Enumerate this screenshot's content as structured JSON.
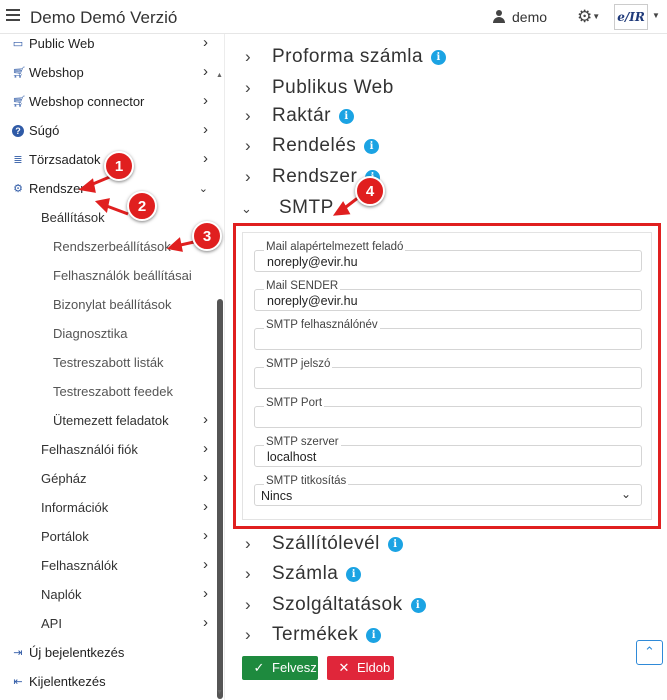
{
  "header": {
    "app_title": "Demo Demó Verzió",
    "user_name": "demo",
    "logo_text": "e/IR"
  },
  "sidebar": {
    "items": [
      {
        "label": "Public Web",
        "icon": "monitor-icon"
      },
      {
        "label": "Webshop",
        "icon": "cart-icon"
      },
      {
        "label": "Webshop connector",
        "icon": "cart-icon"
      },
      {
        "label": "Súgó",
        "icon": "question-icon"
      },
      {
        "label": "Törzsadatok",
        "icon": "database-icon"
      },
      {
        "label": "Rendszer",
        "icon": "gears-icon"
      },
      {
        "label": "Beállítások"
      },
      {
        "label": "Rendszerbeállítások"
      },
      {
        "label": "Felhasználók beállításai"
      },
      {
        "label": "Bizonylat beállítások"
      },
      {
        "label": "Diagnosztika"
      },
      {
        "label": "Testreszabott listák"
      },
      {
        "label": "Testreszabott feedek"
      },
      {
        "label": "Ütemezett feladatok"
      },
      {
        "label": "Felhasználói fiók"
      },
      {
        "label": "Gépház"
      },
      {
        "label": "Információk"
      },
      {
        "label": "Portálok"
      },
      {
        "label": "Felhasználók"
      },
      {
        "label": "Naplók"
      },
      {
        "label": "API"
      },
      {
        "label": "Új bejelentkezés",
        "icon": "sign-in-icon"
      },
      {
        "label": "Kijelentkezés",
        "icon": "sign-out-icon"
      }
    ]
  },
  "callouts": [
    "1",
    "2",
    "3",
    "4"
  ],
  "sections": [
    {
      "title": "Proforma számla",
      "info": true
    },
    {
      "title": "Publikus Web",
      "info": false
    },
    {
      "title": "Raktár",
      "info": true
    },
    {
      "title": "Rendelés",
      "info": true
    },
    {
      "title": "Rendszer",
      "info": true
    },
    {
      "title": "SMTP",
      "info": false
    },
    {
      "title": "Szállítólevél",
      "info": true
    },
    {
      "title": "Számla",
      "info": true
    },
    {
      "title": "Szolgáltatások",
      "info": true
    },
    {
      "title": "Termékek",
      "info": true
    }
  ],
  "smtp": {
    "fields": [
      {
        "label": "Mail alapértelmezett feladó",
        "value": "noreply@evir.hu"
      },
      {
        "label": "Mail SENDER",
        "value": "noreply@evir.hu"
      },
      {
        "label": "SMTP felhasználónév",
        "value": ""
      },
      {
        "label": "SMTP jelszó",
        "value": ""
      },
      {
        "label": "SMTP Port",
        "value": ""
      },
      {
        "label": "SMTP szerver",
        "value": "localhost"
      },
      {
        "label": "SMTP titkosítás",
        "value": "Nincs"
      }
    ]
  },
  "buttons": {
    "save": "Felvesz",
    "discard": "Eldob"
  },
  "colors": {
    "accent_red": "#e01f1f",
    "save_green": "#1e8a3e",
    "discard_red": "#e0263a",
    "info_blue": "#1ba3e3"
  }
}
